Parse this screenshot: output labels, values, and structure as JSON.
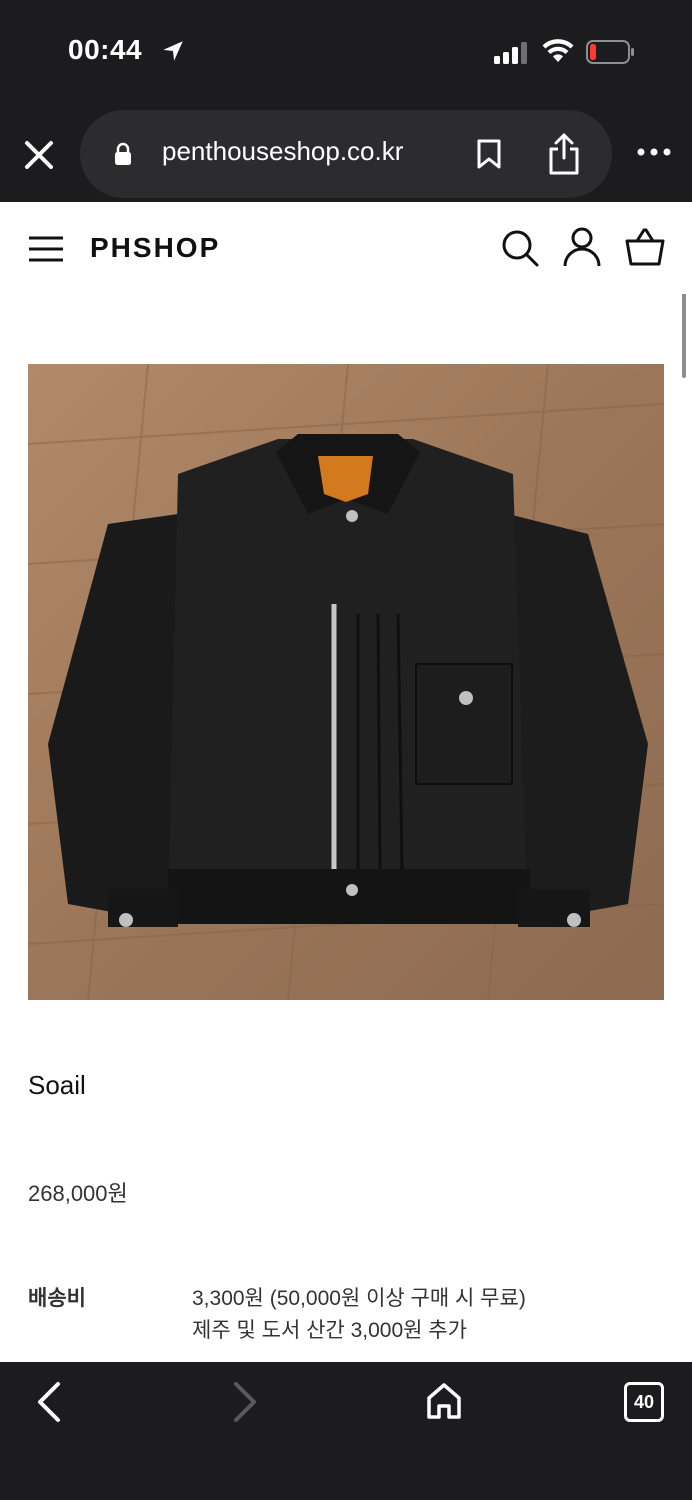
{
  "status_bar": {
    "time": "00:44"
  },
  "browser": {
    "url": "penthouseshop.co.kr",
    "tab_count": "40"
  },
  "header": {
    "logo": "PHSHOP"
  },
  "product": {
    "name": "Soail",
    "price": "268,000원",
    "shipping_label": "배송비",
    "shipping_line1": "3,300원 (50,000원 이상 구매 시 무료)",
    "shipping_line2": "제주 및 도서 산간 3,000원 추가"
  },
  "colors": {
    "battery_low": "#ff3b30",
    "bar_bg": "#1c1c1e"
  }
}
